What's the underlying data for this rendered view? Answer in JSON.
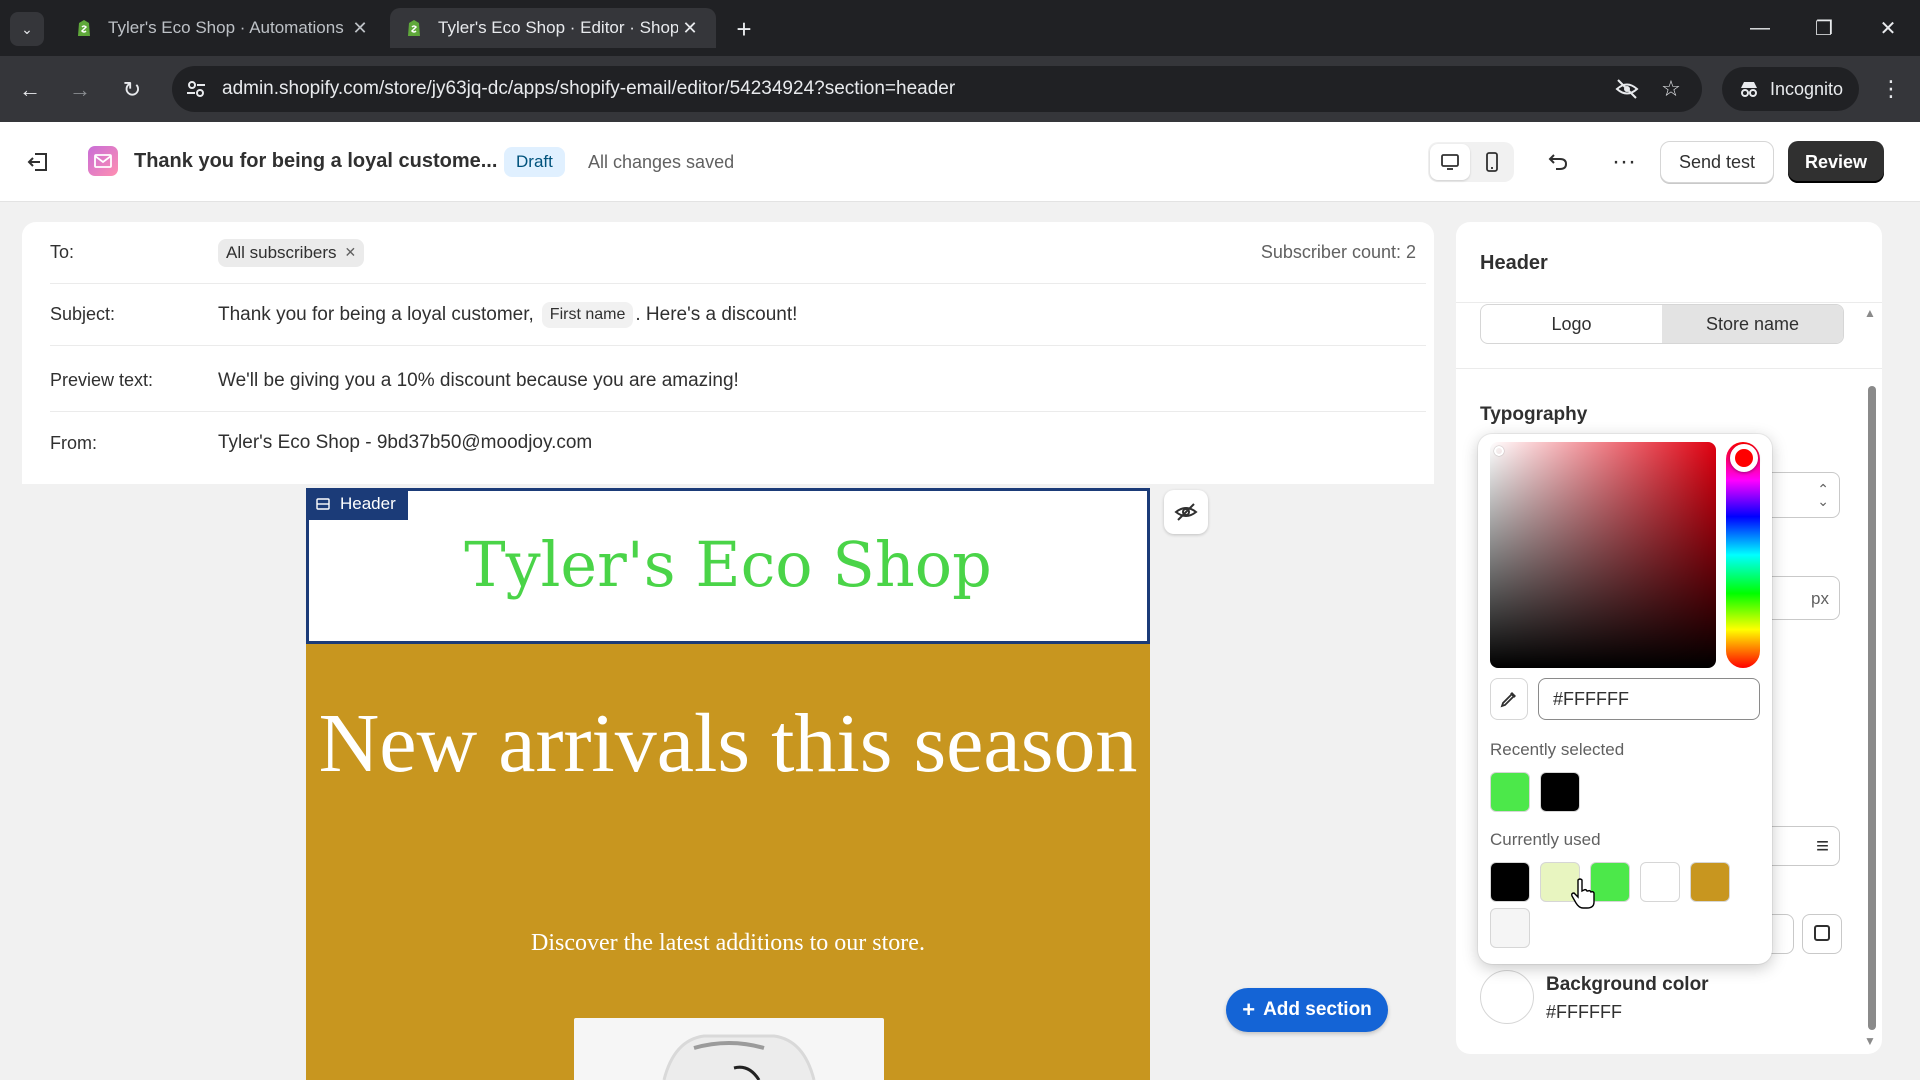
{
  "browser": {
    "tabs": [
      {
        "title": "Tyler's Eco Shop · Automations",
        "active": false
      },
      {
        "title": "Tyler's Eco Shop · Editor · Shopify",
        "active": true
      }
    ],
    "url": "admin.shopify.com/store/jy63jq-dc/apps/shopify-email/editor/54234924?section=header",
    "incognito_label": "Incognito"
  },
  "appbar": {
    "title": "Thank you for being a loyal custome...",
    "status_badge": "Draft",
    "save_status": "All changes saved",
    "send_test_label": "Send test",
    "review_label": "Review"
  },
  "details": {
    "to_label": "To:",
    "to_chip": "All subscribers",
    "subscriber_count": "Subscriber count: 2",
    "subject_label": "Subject:",
    "subject_before": "Thank you for being a loyal customer,",
    "subject_token": "First name",
    "subject_after": ". Here's a discount!",
    "preview_label": "Preview text:",
    "preview_value": "We'll be giving you a 10% discount because you are amazing!",
    "from_label": "From:",
    "from_value": "Tyler's Eco Shop - 9bd37b50@moodjoy.com"
  },
  "canvas": {
    "header_tag": "Header",
    "store_name": "Tyler's Eco Shop",
    "hero_title": "New arrivals this season",
    "hero_subtitle": "Discover the latest additions to our store.",
    "add_section_label": "Add section"
  },
  "panel": {
    "title": "Header",
    "segments": [
      "Logo",
      "Store name"
    ],
    "selected_segment": "Store name",
    "typography_label": "Typography",
    "unit_px": "px",
    "background_color_label": "Background color",
    "background_color_value": "#FFFFFF"
  },
  "picker": {
    "hex_value": "#FFFFFF",
    "recently_selected_label": "Recently selected",
    "recently_selected": [
      "#4ce84a",
      "#000000"
    ],
    "currently_used_label": "Currently used",
    "currently_used": [
      "#000000",
      "#e8f5c0",
      "#4ce84a",
      "#ffffff",
      "#c8961f",
      "#f5f5f5"
    ]
  },
  "colors": {
    "store_name_green": "#4ad448",
    "hero_gold": "#c8961f",
    "header_outline": "#1b3b78",
    "primary_blue": "#1464d6"
  }
}
